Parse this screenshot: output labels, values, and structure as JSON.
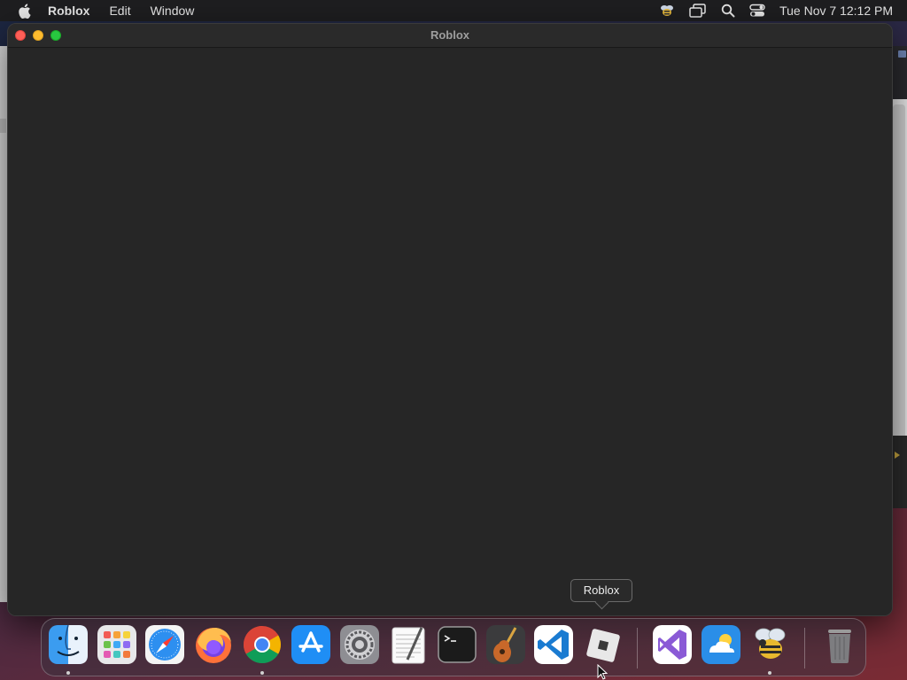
{
  "menubar": {
    "app_name": "Roblox",
    "menus": [
      "Edit",
      "Window"
    ],
    "clock": "Tue Nov 7  12:12 PM",
    "status_icons": [
      "bee-status-icon",
      "screen-mirroring-icon",
      "spotlight-search-icon",
      "control-center-icon"
    ]
  },
  "window": {
    "title": "Roblox"
  },
  "tooltip": {
    "text": "Roblox"
  },
  "dock": {
    "items": [
      {
        "name": "finder",
        "running": true
      },
      {
        "name": "launchpad",
        "running": false
      },
      {
        "name": "safari",
        "running": false
      },
      {
        "name": "firefox",
        "running": false
      },
      {
        "name": "chrome",
        "running": true
      },
      {
        "name": "app-store",
        "running": false
      },
      {
        "name": "system-settings",
        "running": false
      },
      {
        "name": "textedit",
        "running": false
      },
      {
        "name": "terminal",
        "running": false
      },
      {
        "name": "garageband",
        "running": false
      },
      {
        "name": "visual-studio-code",
        "running": false
      },
      {
        "name": "roblox",
        "running": true
      },
      {
        "name": "visual-studio",
        "running": false
      },
      {
        "name": "weather",
        "running": false
      },
      {
        "name": "bee",
        "running": true
      },
      {
        "name": "trash",
        "running": false
      }
    ]
  },
  "colors": {
    "window_bg": "#262626",
    "menubar_bg": "#1e1e20",
    "close": "#ff5f57",
    "minimize": "#febc2e",
    "maximize": "#28c840"
  }
}
